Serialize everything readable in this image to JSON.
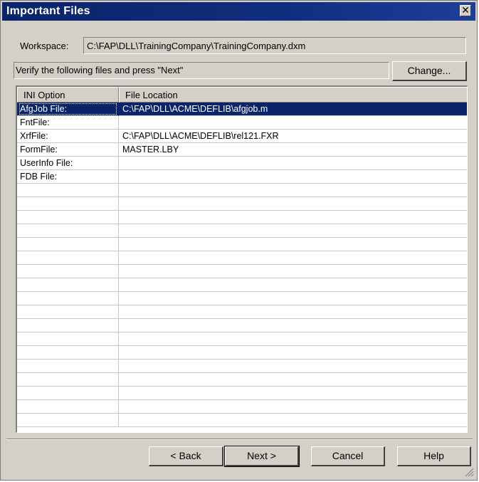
{
  "window": {
    "title": "Important Files",
    "close_glyph": "✕"
  },
  "workspace": {
    "label": "Workspace:",
    "value": "C:\\FAP\\DLL\\TrainingCompany\\TrainingCompany.dxm"
  },
  "instruction": "Verify the following files and press \"Next\"",
  "buttons": {
    "change": "Change...",
    "back": "< Back",
    "next": "Next >",
    "cancel": "Cancel",
    "help": "Help"
  },
  "table": {
    "columns": [
      "INI Option",
      "File Location"
    ],
    "rows": [
      {
        "option": "AfgJob File:",
        "location": "C:\\FAP\\DLL\\ACME\\DEFLIB\\afgjob.m",
        "selected": true
      },
      {
        "option": "FntFile:",
        "location": ""
      },
      {
        "option": "XrfFile:",
        "location": "C:\\FAP\\DLL\\ACME\\DEFLIB\\rel121.FXR"
      },
      {
        "option": "FormFile:",
        "location": "MASTER.LBY"
      },
      {
        "option": "UserInfo File:",
        "location": ""
      },
      {
        "option": "FDB File:",
        "location": ""
      }
    ]
  },
  "colors": {
    "titlebar": "#0a246a",
    "face": "#d4d0c8",
    "selection": "#0a246a"
  }
}
